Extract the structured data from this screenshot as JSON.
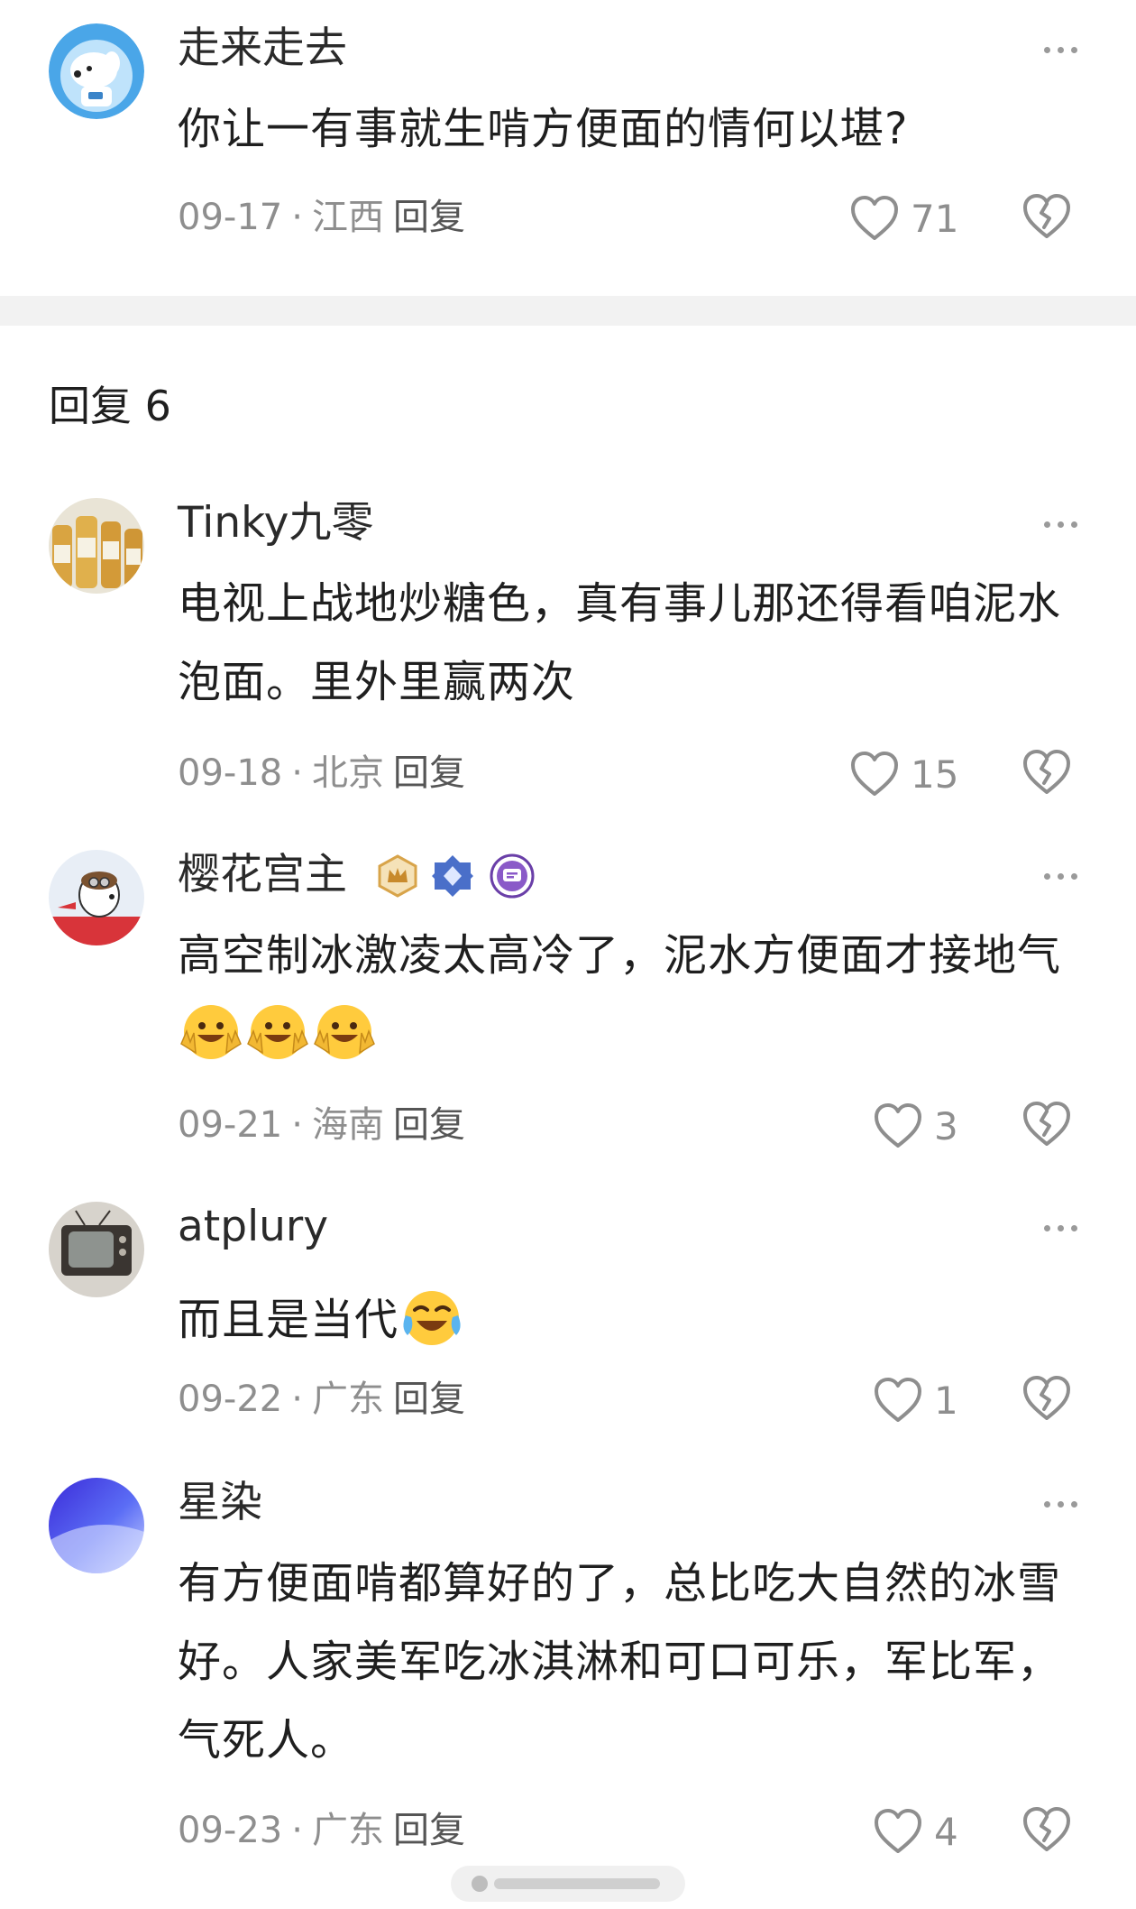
{
  "top_comment": {
    "username": "走来走去",
    "text": "你让一有事就生啃方便面的情何以堪?",
    "date": "09-17",
    "location": "江西",
    "reply_label": "回复",
    "likes": "71"
  },
  "replies_header": "回复 6",
  "replies": [
    {
      "username": "Tinky九零",
      "text": "电视上战地炒糖色，真有事儿那还得看咱泥水泡面。里外里赢两次",
      "date": "09-18",
      "location": "北京",
      "reply_label": "回复",
      "likes": "15"
    },
    {
      "username": "樱花宫主",
      "text": "高空制冰激凌太高冷了，泥水方便面才接地气",
      "emoji": "v-sign-emoji",
      "date": "09-21",
      "location": "海南",
      "reply_label": "回复",
      "likes": "3"
    },
    {
      "username": "atplury",
      "text": "而且是当代",
      "emoji": "laughing-crying-emoji",
      "date": "09-22",
      "location": "广东",
      "reply_label": "回复",
      "likes": "1"
    },
    {
      "username": "星染",
      "text": "有方便面啃都算好的了，总比吃大自然的冰雪好。人家美军吃冰淇淋和可口可乐，军比军，气死人。",
      "date": "09-23",
      "location": "广东",
      "reply_label": "回复",
      "likes": "4"
    }
  ],
  "icons": {
    "like": "heart-outline-icon",
    "dislike": "broken-heart-icon",
    "more": "more-dots-icon"
  },
  "colors": {
    "meta_gray": "#8e8e8e",
    "divider": "#f2f2f2"
  }
}
